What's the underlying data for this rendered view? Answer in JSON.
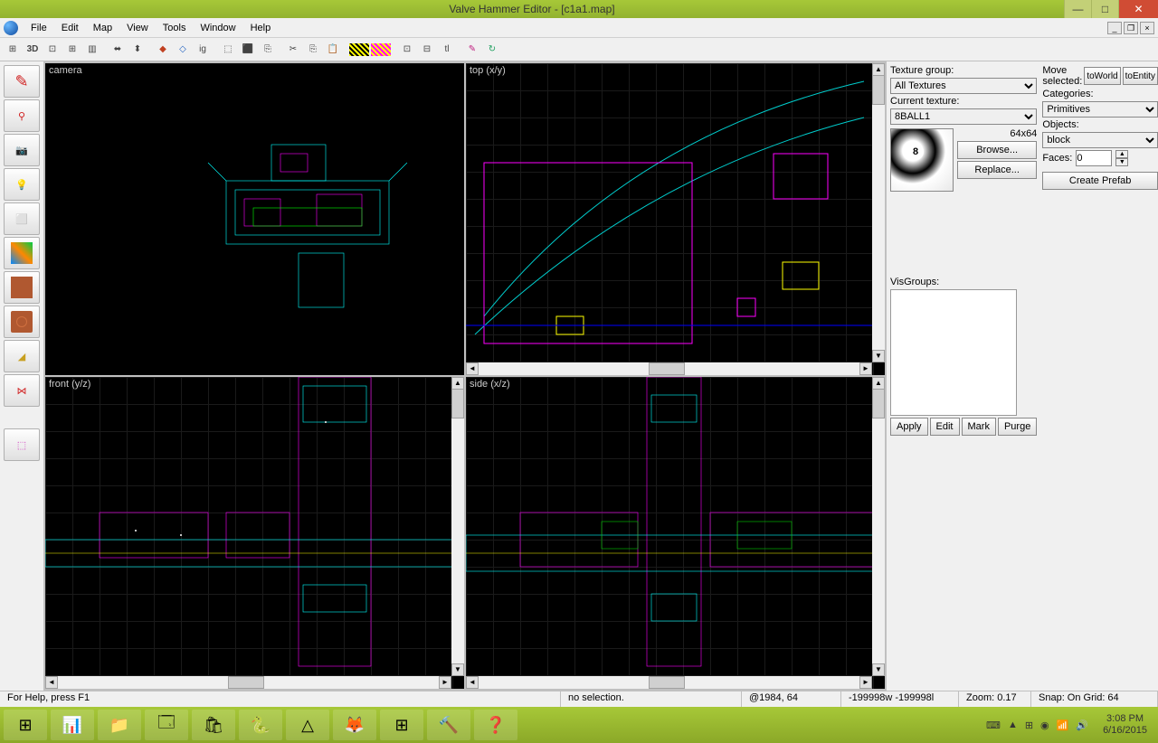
{
  "window": {
    "title": "Valve Hammer Editor - [c1a1.map]"
  },
  "menu": [
    "File",
    "Edit",
    "Map",
    "View",
    "Tools",
    "Window",
    "Help"
  ],
  "viewports": {
    "tl": "camera",
    "tr": "top (x/y)",
    "bl": "front (y/z)",
    "br": "side (x/z)"
  },
  "texture_panel": {
    "group_label": "Texture group:",
    "group_value": "All Textures",
    "current_label": "Current texture:",
    "current_value": "8BALL1",
    "dims": "64x64",
    "browse": "Browse...",
    "replace": "Replace..."
  },
  "object_panel": {
    "move_label": "Move selected:",
    "toWorld": "toWorld",
    "toEntity": "toEntity",
    "categories_label": "Categories:",
    "categories_value": "Primitives",
    "objects_label": "Objects:",
    "objects_value": "block",
    "faces_label": "Faces:",
    "faces_value": "0",
    "create_prefab": "Create Prefab"
  },
  "visgroups": {
    "label": "VisGroups:",
    "buttons": [
      "Apply",
      "Edit",
      "Mark",
      "Purge"
    ]
  },
  "status": {
    "help": "For Help, press F1",
    "selection": "no selection.",
    "coords": "@1984, 64",
    "dims": "-199998w -199998l",
    "zoom": "Zoom: 0.17",
    "snap": "Snap: On Grid: 64"
  },
  "taskbar": {
    "time": "3:08 PM",
    "date": "6/16/2015"
  },
  "toolbar_icons": [
    "⊞",
    "3D",
    "⊡",
    "⊞",
    "▥",
    "⬌",
    "⬇",
    "‖",
    "◆",
    "◇",
    "ig",
    "⬚",
    "⬛",
    "⎘",
    "✂",
    "⎘",
    "📋",
    "⚠",
    "▦",
    "⊡",
    "⊟",
    "tl",
    "✎",
    "↻"
  ]
}
